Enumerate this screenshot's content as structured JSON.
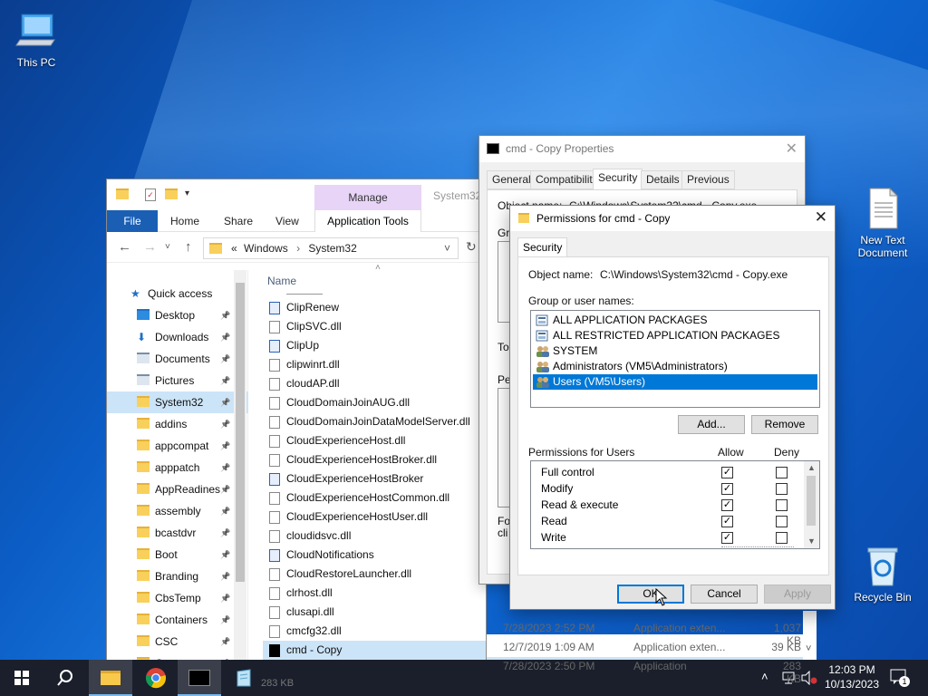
{
  "desktop": {
    "icons": [
      {
        "label": "This PC",
        "icon": "this-pc-icon"
      },
      {
        "label": "New Text Document",
        "icon": "text-document-icon"
      },
      {
        "label": "Recycle Bin",
        "icon": "recycle-bin-icon"
      }
    ]
  },
  "explorer": {
    "title_partial": "System32",
    "manage_tab": "Manage",
    "ribbon": {
      "file": "File",
      "home": "Home",
      "share": "Share",
      "view": "View",
      "app_tools": "Application Tools"
    },
    "address": {
      "prefix": "«",
      "parts": [
        "Windows",
        "System32"
      ],
      "separator": "›"
    },
    "column_name": "Name",
    "nav": [
      {
        "label": "Quick access",
        "pinned": false,
        "icon": "star-icon"
      },
      {
        "label": "Desktop",
        "pinned": true,
        "icon": "desktop-folder-icon"
      },
      {
        "label": "Downloads",
        "pinned": true,
        "icon": "download-arrow-icon"
      },
      {
        "label": "Documents",
        "pinned": true,
        "icon": "documents-icon"
      },
      {
        "label": "Pictures",
        "pinned": true,
        "icon": "pictures-icon"
      },
      {
        "label": "System32",
        "pinned": true,
        "selected": true,
        "icon": "folder-icon"
      },
      {
        "label": "addins",
        "pinned": true,
        "icon": "folder-icon"
      },
      {
        "label": "appcompat",
        "pinned": true,
        "icon": "folder-icon"
      },
      {
        "label": "apppatch",
        "pinned": true,
        "icon": "folder-icon"
      },
      {
        "label": "AppReadines",
        "pinned": true,
        "icon": "folder-icon"
      },
      {
        "label": "assembly",
        "pinned": true,
        "icon": "folder-icon"
      },
      {
        "label": "bcastdvr",
        "pinned": true,
        "icon": "folder-icon"
      },
      {
        "label": "Boot",
        "pinned": true,
        "icon": "folder-icon"
      },
      {
        "label": "Branding",
        "pinned": true,
        "icon": "folder-icon"
      },
      {
        "label": "CbsTemp",
        "pinned": true,
        "icon": "folder-icon"
      },
      {
        "label": "Containers",
        "pinned": true,
        "icon": "folder-icon"
      },
      {
        "label": "CSC",
        "pinned": true,
        "icon": "folder-icon"
      },
      {
        "label": "Cursors",
        "pinned": true,
        "icon": "folder-icon"
      }
    ],
    "files": [
      {
        "name": "ClipRenew",
        "type": "exe"
      },
      {
        "name": "ClipSVC.dll",
        "type": "dll"
      },
      {
        "name": "ClipUp",
        "type": "exe"
      },
      {
        "name": "clipwinrt.dll",
        "type": "dll"
      },
      {
        "name": "cloudAP.dll",
        "type": "dll"
      },
      {
        "name": "CloudDomainJoinAUG.dll",
        "type": "dll"
      },
      {
        "name": "CloudDomainJoinDataModelServer.dll",
        "type": "dll"
      },
      {
        "name": "CloudExperienceHost.dll",
        "type": "dll"
      },
      {
        "name": "CloudExperienceHostBroker.dll",
        "type": "dll"
      },
      {
        "name": "CloudExperienceHostBroker",
        "type": "exe"
      },
      {
        "name": "CloudExperienceHostCommon.dll",
        "type": "dll"
      },
      {
        "name": "CloudExperienceHostUser.dll",
        "type": "dll"
      },
      {
        "name": "cloudidsvc.dll",
        "type": "dll"
      },
      {
        "name": "CloudNotifications",
        "type": "exe"
      },
      {
        "name": "CloudRestoreLauncher.dll",
        "type": "dll"
      },
      {
        "name": "clrhost.dll",
        "type": "dll"
      },
      {
        "name": "clusapi.dll",
        "type": "dll"
      },
      {
        "name": "cmcfg32.dll",
        "type": "dll"
      },
      {
        "name": "cmd - Copy",
        "type": "cmd",
        "selected": true
      }
    ],
    "bg_rows": [
      {
        "date": "7/28/2023 2:52 PM",
        "type": "Application exten...",
        "size": "1,037 KB"
      },
      {
        "date": "12/7/2019 1:09 AM",
        "type": "Application exten...",
        "size": "39 KB"
      },
      {
        "date": "7/28/2023 2:50 PM",
        "type": "Application",
        "size": "283 KB"
      }
    ],
    "status_size": "283 KB"
  },
  "properties": {
    "title": "cmd - Copy Properties",
    "tabs": [
      "General",
      "Compatibility",
      "Security",
      "Details",
      "Previous Versions"
    ],
    "active_tab": "Security",
    "fragments": {
      "object": "Object name:",
      "object_path": "C:\\Windows\\System32\\cmd - Copy.exe",
      "gr": "Gr",
      "to": "To",
      "pe": "Pe",
      "fo": "Fo",
      "cli": "cli"
    }
  },
  "permissions": {
    "title": "Permissions for cmd - Copy",
    "tab": "Security",
    "object_label": "Object name:",
    "object_value": "C:\\Windows\\System32\\cmd - Copy.exe",
    "group_label": "Group or user names:",
    "groups": [
      {
        "name": "ALL APPLICATION PACKAGES",
        "icon": "package-group-icon"
      },
      {
        "name": "ALL RESTRICTED APPLICATION PACKAGES",
        "icon": "package-group-icon"
      },
      {
        "name": "SYSTEM",
        "icon": "user-group-icon"
      },
      {
        "name": "Administrators (VM5\\Administrators)",
        "icon": "user-group-icon"
      },
      {
        "name": "Users (VM5\\Users)",
        "icon": "user-group-icon",
        "selected": true
      }
    ],
    "add_btn": "Add...",
    "remove_btn": "Remove",
    "perm_label": "Permissions for Users",
    "allow_label": "Allow",
    "deny_label": "Deny",
    "perms": [
      {
        "name": "Full control",
        "allow": true,
        "deny": false
      },
      {
        "name": "Modify",
        "allow": true,
        "deny": false
      },
      {
        "name": "Read & execute",
        "allow": true,
        "deny": false
      },
      {
        "name": "Read",
        "allow": true,
        "deny": false
      },
      {
        "name": "Write",
        "allow": true,
        "deny": false
      }
    ],
    "ok_btn": "OK",
    "cancel_btn": "Cancel",
    "apply_btn": "Apply"
  },
  "taskbar": {
    "time": "12:03 PM",
    "date": "10/13/2023",
    "notification_count": "1",
    "apps": [
      "file-explorer-icon",
      "chrome-icon",
      "cmd-icon",
      "notepad-icon"
    ]
  },
  "colors": {
    "accent": "#0078d7",
    "taskbar": "#1a1f2b",
    "manage": "#e7d4f7",
    "file_tab": "#1a5fb4"
  }
}
